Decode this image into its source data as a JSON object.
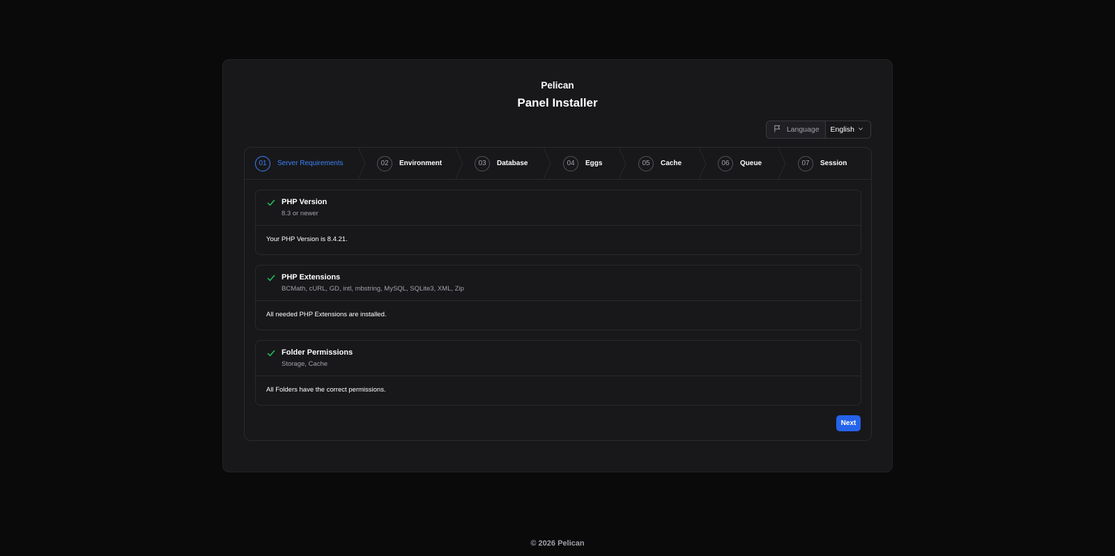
{
  "brand": "Pelican",
  "title": "Panel Installer",
  "language": {
    "label": "Language",
    "selected": "English"
  },
  "steps": [
    {
      "number": "01",
      "label": "Server Requirements",
      "active": true
    },
    {
      "number": "02",
      "label": "Environment",
      "active": false
    },
    {
      "number": "03",
      "label": "Database",
      "active": false
    },
    {
      "number": "04",
      "label": "Eggs",
      "active": false
    },
    {
      "number": "05",
      "label": "Cache",
      "active": false
    },
    {
      "number": "06",
      "label": "Queue",
      "active": false
    },
    {
      "number": "07",
      "label": "Session",
      "active": false
    }
  ],
  "sections": [
    {
      "title": "PHP Version",
      "subtitle": "8.3 or newer",
      "message": "Your PHP Version is 8.4.21.",
      "status": "ok"
    },
    {
      "title": "PHP Extensions",
      "subtitle": "BCMath, cURL, GD, intl, mbstring, MySQL, SQLite3, XML, Zip",
      "message": "All needed PHP Extensions are installed.",
      "status": "ok"
    },
    {
      "title": "Folder Permissions",
      "subtitle": "Storage, Cache",
      "message": "All Folders have the correct permissions.",
      "status": "ok"
    }
  ],
  "next_label": "Next",
  "footer": "© 2026 Pelican",
  "colors": {
    "accent": "#3b82f6",
    "button": "#2563eb",
    "success": "#22c55e",
    "background": "#0a0a0b",
    "card": "#18181b"
  },
  "icons": {
    "language": "flag-icon",
    "dropdown": "chevron-down-icon",
    "status_ok": "check-icon"
  }
}
